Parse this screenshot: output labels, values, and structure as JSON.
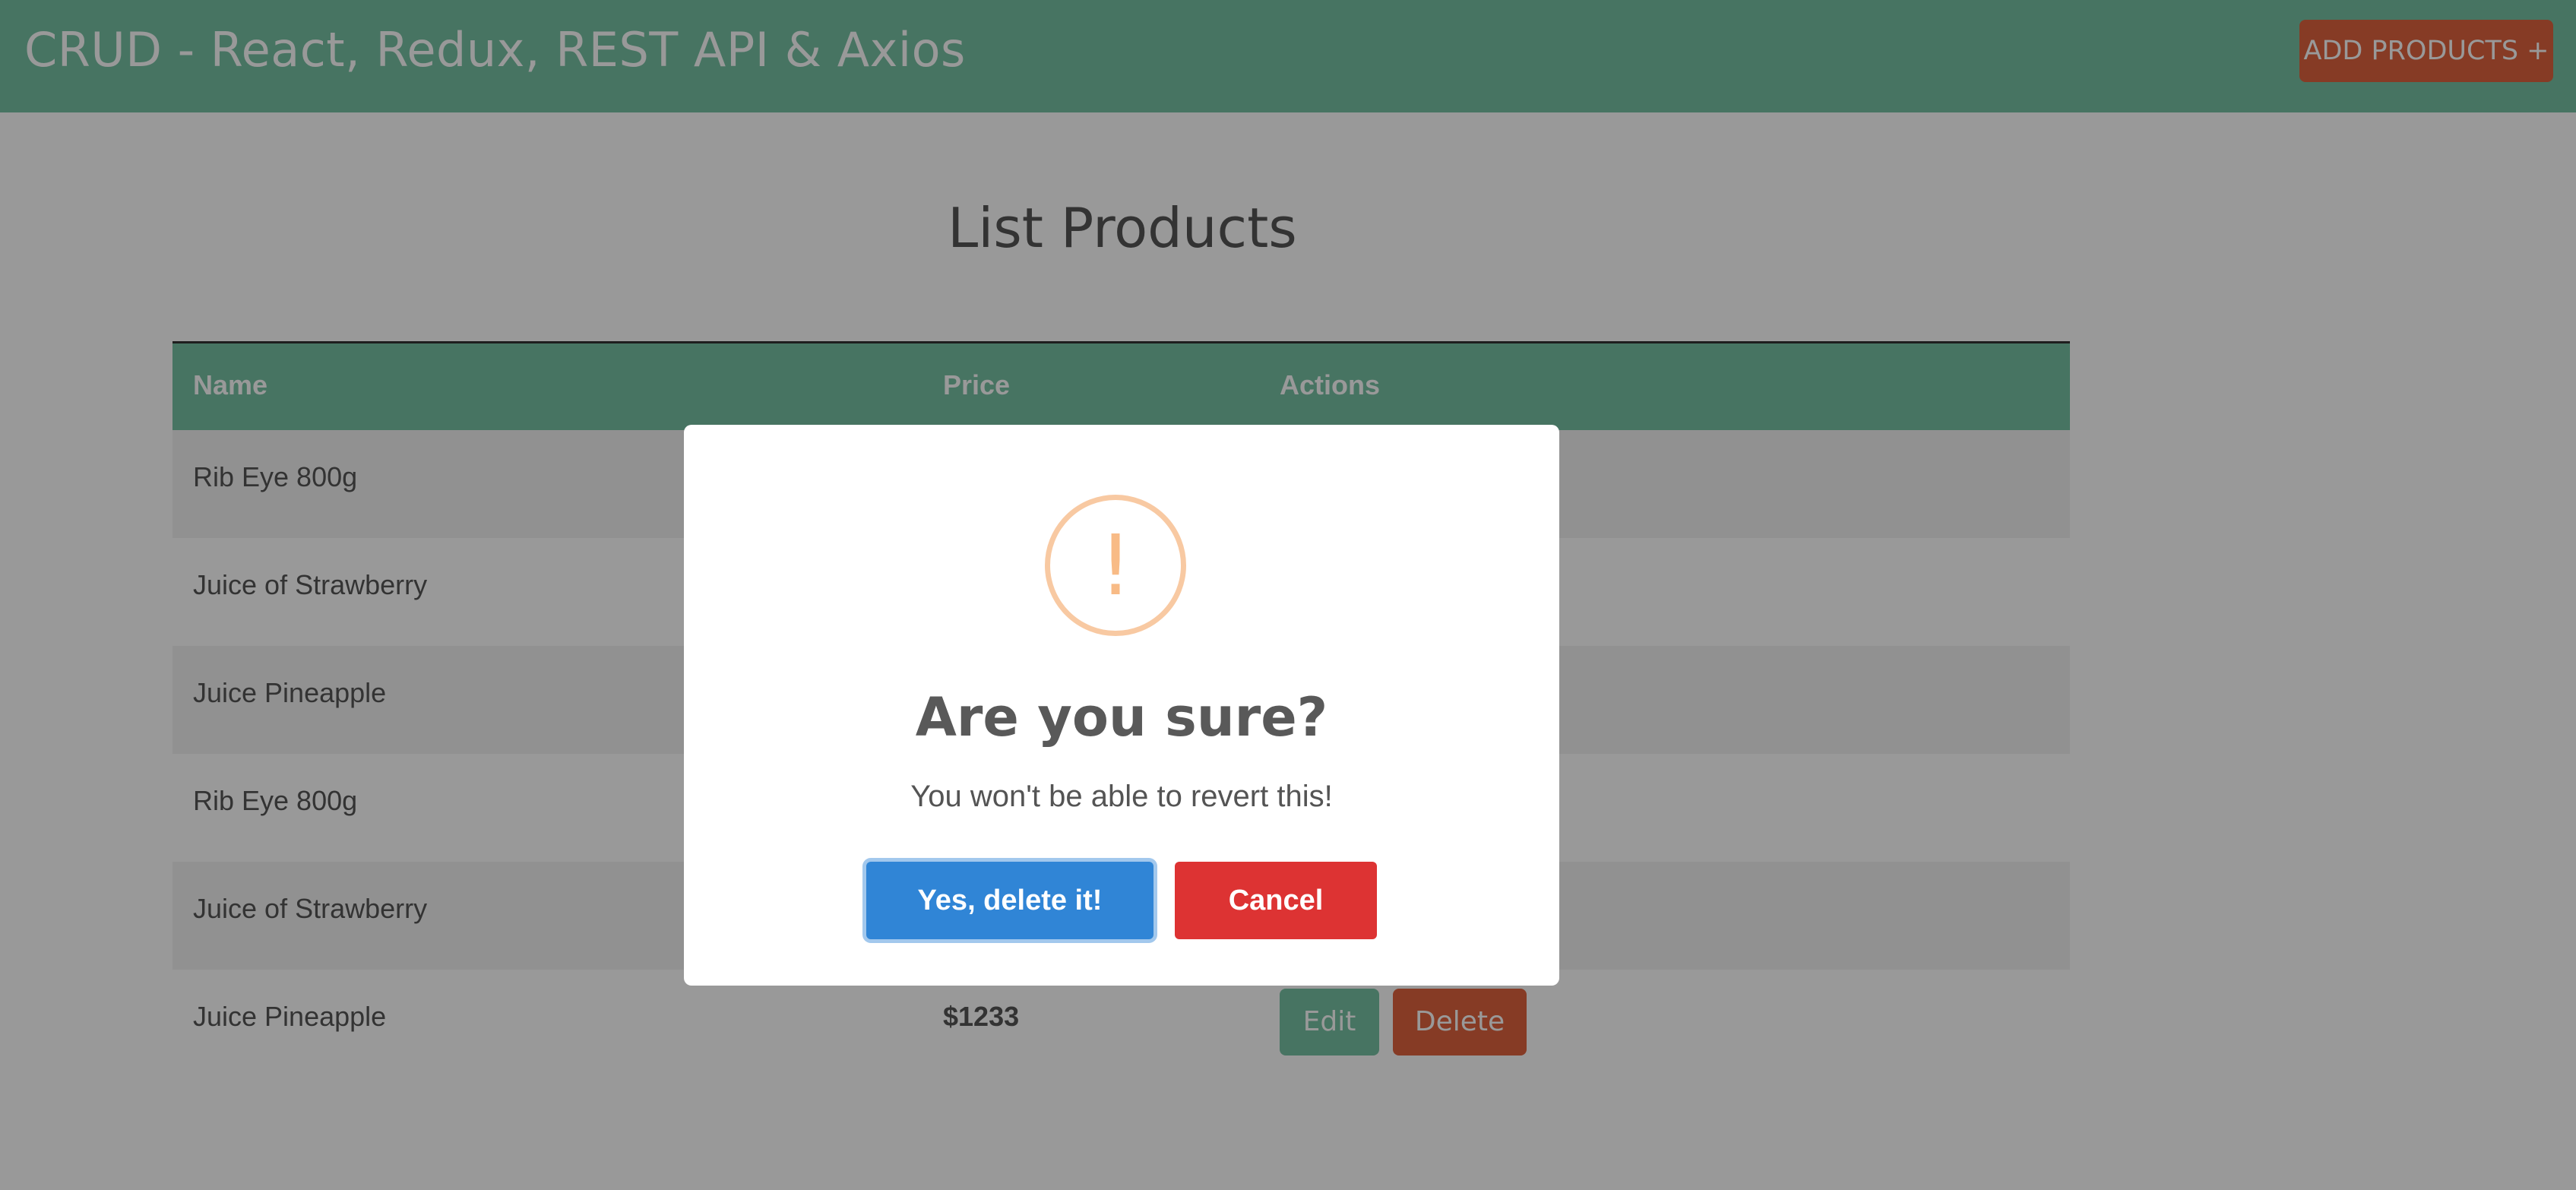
{
  "navbar": {
    "brand": "CRUD - React, Redux, REST API & Axios",
    "add_button": "ADD PRODUCTS +"
  },
  "main": {
    "title": "List Products",
    "table": {
      "headers": [
        "Name",
        "Price",
        "Actions"
      ],
      "rows": [
        {
          "name": "Rib Eye 800g",
          "price": ""
        },
        {
          "name": "Juice of Strawberry",
          "price": ""
        },
        {
          "name": "Juice Pineapple",
          "price": ""
        },
        {
          "name": "Rib Eye 800g",
          "price": ""
        },
        {
          "name": "Juice of Strawberry",
          "price": ""
        },
        {
          "name": "Juice Pineapple",
          "price": "$1233"
        }
      ],
      "edit_label": "Edit",
      "delete_label": "Delete"
    }
  },
  "dialog": {
    "icon": "warning-icon",
    "icon_glyph": "!",
    "title": "Are you sure?",
    "text": "You won't be able to revert this!",
    "confirm_label": "Yes, delete it!",
    "cancel_label": "Cancel"
  },
  "colors": {
    "brand": "#77c2a4",
    "danger_action": "#e0633f",
    "confirm": "#3085d6",
    "cancel": "#dd3333",
    "warning": "#f8bb86"
  }
}
